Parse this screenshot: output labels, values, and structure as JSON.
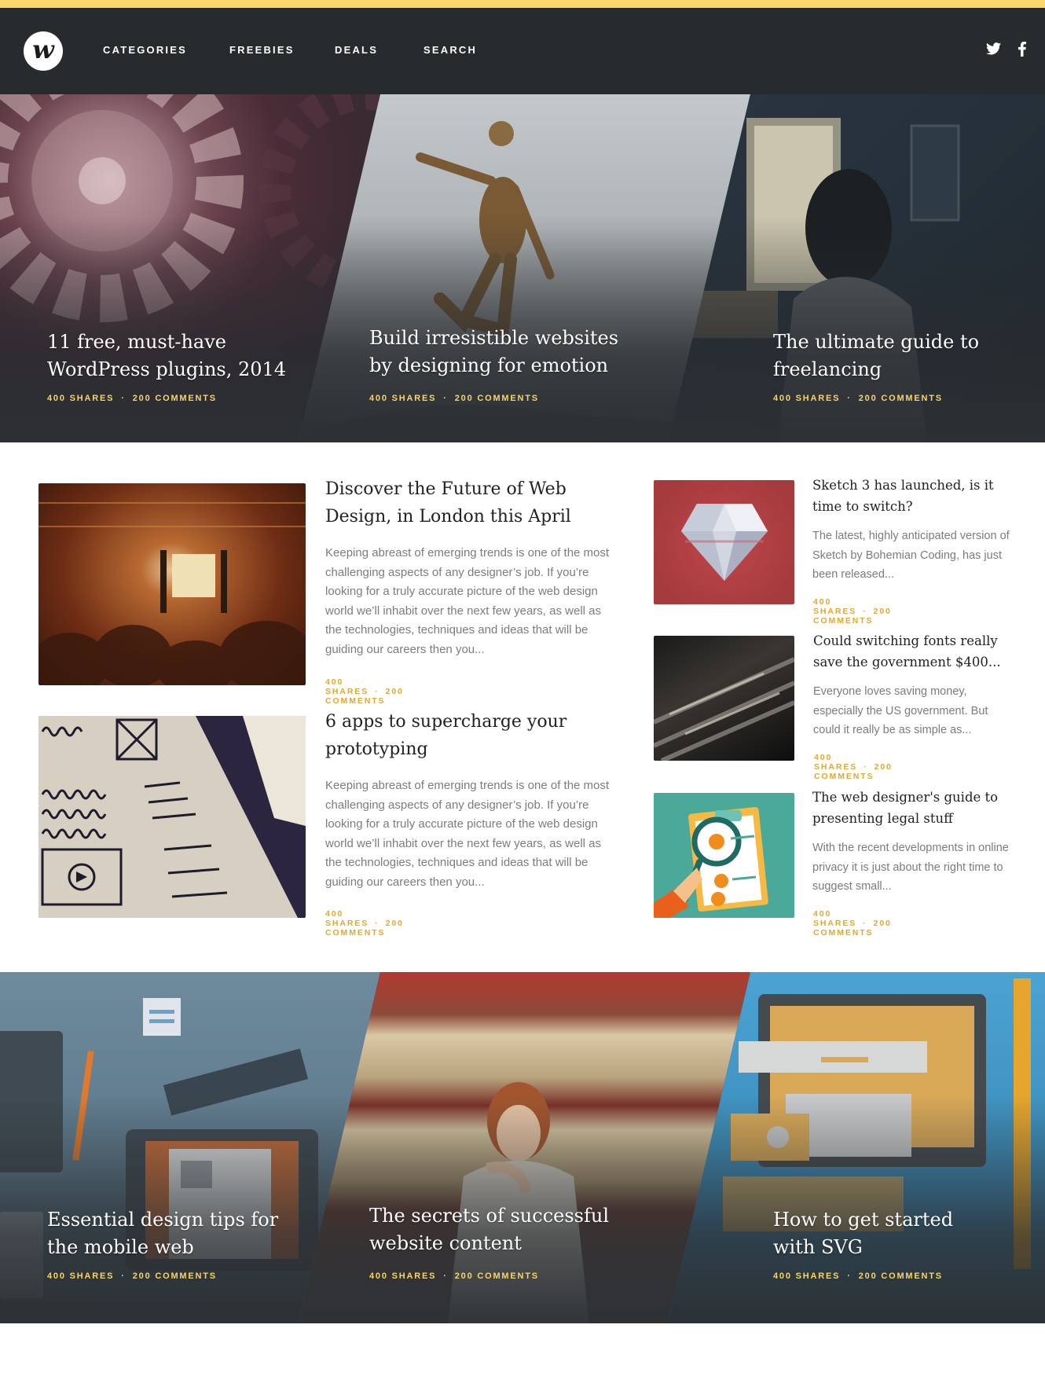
{
  "header": {
    "logo_letter": "w",
    "nav": [
      "CATEGORIES",
      "FREEBIES",
      "DEALS",
      "SEARCH"
    ],
    "social": [
      "twitter-icon",
      "facebook-icon"
    ]
  },
  "colors": {
    "accent_bar": "#fbd86d",
    "header_bg": "#272b2e",
    "hero_meta": "#f7d56b",
    "card_meta": "#e0a82e"
  },
  "hero_top": [
    {
      "title": "11 free, must-have WordPress plugins, 2014",
      "shares": "400 SHARES",
      "comments": "200 COMMENTS",
      "image": "gears-photo"
    },
    {
      "title": "Build irresistible websites by designing for emotion",
      "shares": "400 SHARES",
      "comments": "200 COMMENTS",
      "image": "jumping-man-photo"
    },
    {
      "title": "The ultimate guide to freelancing",
      "shares": "400 SHARES",
      "comments": "200 COMMENTS",
      "image": "woman-at-computer-photo"
    }
  ],
  "featured": [
    {
      "title": "Discover the Future of Web Design, in London this April",
      "excerpt": "Keeping abreast of emerging trends is one of the most challenging aspects of any designer’s job. If you’re looking for a truly accurate picture of the web design world we’ll inhabit over the next few years, as well as the technologies, techniques and ideas that will be guiding our careers then you...",
      "shares": "400 SHARES",
      "comments": "200 COMMENTS",
      "image": "conference-photo"
    },
    {
      "title": "6 apps to supercharge your prototyping",
      "excerpt": "Keeping abreast of emerging trends is one of the most challenging aspects of any designer’s job. If you’re looking for a truly accurate picture of the web design world we’ll inhabit over the next few years, as well as the technologies, techniques and ideas that will be guiding our careers then you...",
      "shares": "400 SHARES",
      "comments": "200 COMMENTS",
      "image": "wireframe-sketch-photo"
    }
  ],
  "sidebar_posts": [
    {
      "title": "Sketch 3 has launched, is it time to switch?",
      "excerpt": "The latest, highly anticipated version of Sketch by Bohemian Coding, has just been released...",
      "shares": "400 SHARES",
      "comments": "200 COMMENTS",
      "image": "sketch-diamond"
    },
    {
      "title": "Could switching fonts really save the government $400...",
      "excerpt": "Everyone loves saving money, especially the US government. But could it really be as simple as...",
      "shares": "400 SHARES",
      "comments": "200 COMMENTS",
      "image": "metal-type-photo"
    },
    {
      "title": "The web designer's guide to presenting legal stuff",
      "excerpt": "With the recent developments in online privacy it is just about the right time to suggest small...",
      "shares": "400 SHARES",
      "comments": "200 COMMENTS",
      "image": "clipboard-checklist"
    }
  ],
  "hero_bottom": [
    {
      "title": "Essential design tips for the mobile web",
      "shares": "400 SHARES",
      "comments": "200 COMMENTS",
      "image": "designer-desk-illustration"
    },
    {
      "title": "The secrets of successful website content",
      "shares": "400 SHARES",
      "comments": "200 COMMENTS",
      "image": "woman-reading-library-photo"
    },
    {
      "title": "How to get started with SVG",
      "shares": "400 SHARES",
      "comments": "200 COMMENTS",
      "image": "svg-devices-illustration"
    }
  ],
  "meta_separator": "·"
}
